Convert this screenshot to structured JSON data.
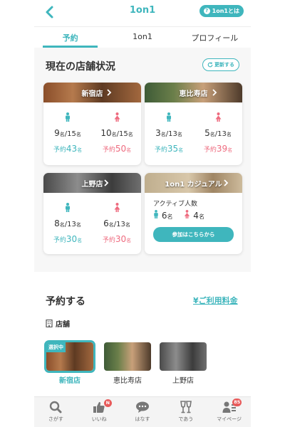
{
  "header": {
    "title": "1on1",
    "about_button": "1on1とは"
  },
  "tabs": [
    {
      "label": "予約",
      "active": true
    },
    {
      "label": "1on1",
      "active": false
    },
    {
      "label": "プロフィール",
      "active": false
    }
  ],
  "status": {
    "title": "現在の店舗状況",
    "refresh_label": "更新する",
    "stores": [
      {
        "name": "新宿店",
        "male": {
          "current": "9",
          "capacity": "/15",
          "unit": "名",
          "reserved": "43"
        },
        "female": {
          "current": "10",
          "capacity": "/15",
          "unit": "名",
          "reserved": "50"
        },
        "reserve_label": "予約"
      },
      {
        "name": "恵比寿店",
        "male": {
          "current": "3",
          "capacity": "/13",
          "unit": "名",
          "reserved": "35"
        },
        "female": {
          "current": "5",
          "capacity": "/13",
          "unit": "名",
          "reserved": "39"
        },
        "reserve_label": "予約"
      },
      {
        "name": "上野店",
        "male": {
          "current": "8",
          "capacity": "/13",
          "unit": "名",
          "reserved": "30"
        },
        "female": {
          "current": "6",
          "capacity": "/13",
          "unit": "名",
          "reserved": "30"
        },
        "reserve_label": "予約"
      }
    ],
    "casual": {
      "name": "1on1 カジュアル",
      "active_label": "アクティブ人数",
      "male": "6",
      "female": "4",
      "unit": "名",
      "join_button": "参加はこちらから"
    }
  },
  "reserve": {
    "title": "予約する",
    "price_link": "¥ご利用料金",
    "store_label": "店舗",
    "selected_badge": "選択中",
    "stores": [
      {
        "label": "新宿店",
        "selected": true
      },
      {
        "label": "恵比寿店",
        "selected": false
      },
      {
        "label": "上野店",
        "selected": false
      }
    ]
  },
  "nav": [
    {
      "label": "さがす",
      "icon": "search-icon"
    },
    {
      "label": "いいね",
      "icon": "thumbs-up-icon",
      "badge": "N"
    },
    {
      "label": "はなす",
      "icon": "chat-icon"
    },
    {
      "label": "であう",
      "icon": "glasses-icon"
    },
    {
      "label": "マイページ",
      "icon": "profile-icon",
      "badge": "85"
    }
  ],
  "colors": {
    "accent": "#3fb6bd",
    "female": "#ee6b7f",
    "badge": "#e85a5a"
  }
}
